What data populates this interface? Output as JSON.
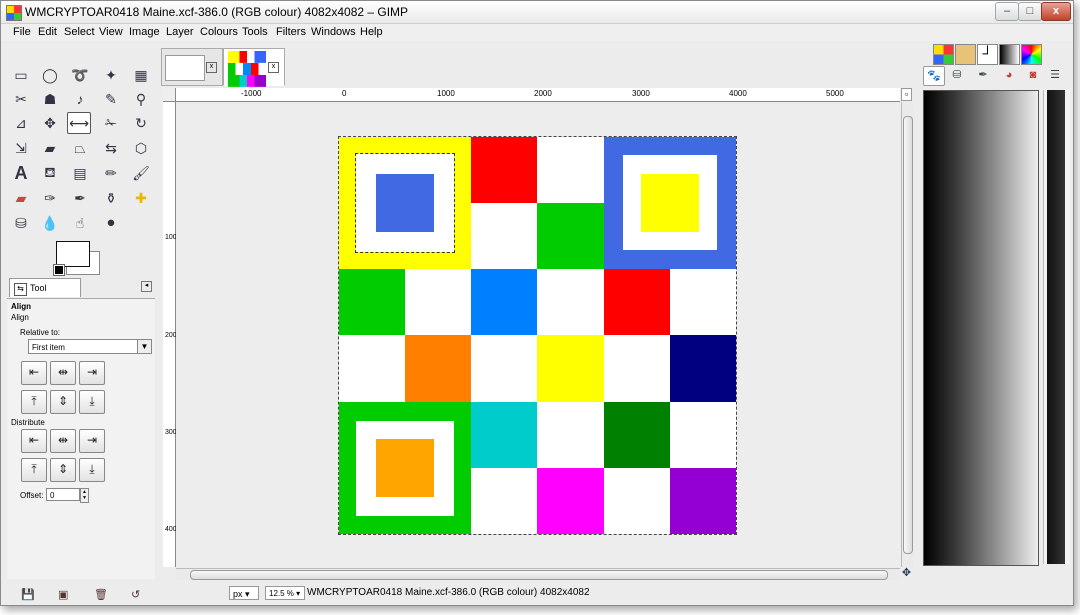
{
  "window": {
    "title": "WMCRYPTOAR0418 Maine.xcf-386.0 (RGB colour) 4082x4082 – GIMP",
    "controls": {
      "minimize": "–",
      "maximize": "□",
      "close": "x"
    }
  },
  "menu": [
    "File",
    "Edit",
    "Select",
    "View",
    "Image",
    "Layer",
    "Colours",
    "Tools",
    "Filters",
    "Windows",
    "Help"
  ],
  "tool_options": {
    "tab_label": "Tool Options",
    "tool_name": "Align",
    "tool_subtitle": "Align",
    "relative_to_label": "Relative to:",
    "relative_to_value": "First item",
    "distribute_label": "Distribute",
    "offset_label": "Offset:",
    "offset_value": "0"
  },
  "image_tabs": [
    {
      "close": "x"
    },
    {
      "close": "x"
    }
  ],
  "ruler": {
    "h_labels": [
      "-1000",
      "0",
      "1000",
      "2000",
      "3000",
      "4000",
      "5000"
    ],
    "v_labels": [
      "1000",
      "2000",
      "3000",
      "4000"
    ]
  },
  "status": {
    "unit": "px",
    "zoom": "12.5 %",
    "text": "WMCRYPTOAR0418 Maine.xcf-386.0 (RGB colour) 4082x4082"
  },
  "grid_colors": {
    "yellow": "#ffff00",
    "blue": "#4169e1",
    "red": "#ff0000",
    "green": "#00cc00",
    "azure": "#007fff",
    "orange": "#ff8000",
    "navy": "#000080",
    "cyan": "#00cccc",
    "dark_green": "#008000",
    "magenta": "#ff00ff",
    "purple": "#9400d3",
    "amber": "#ffa500"
  }
}
